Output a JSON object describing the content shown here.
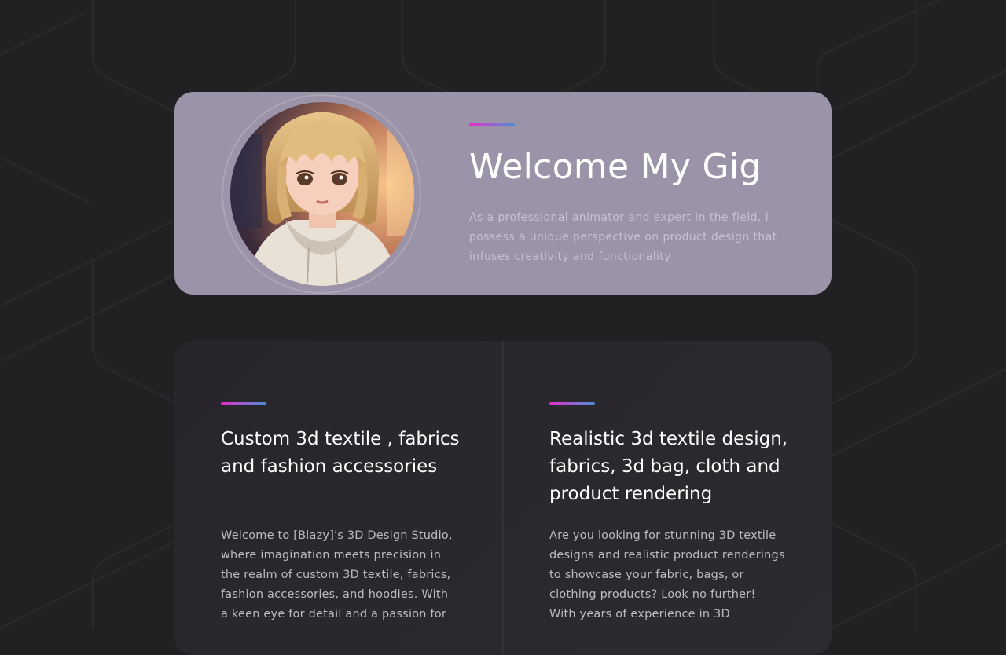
{
  "hero": {
    "title": "Welcome My Gig",
    "description": "As a professional animator and expert in the field, I possess a unique perspective on product design that infuses creativity and functionality"
  },
  "cards": [
    {
      "title": "Custom 3d textile , fabrics and fashion accessories",
      "text": "Welcome to [Blazy]'s 3D Design Studio, where imagination meets precision in the realm of custom 3D textile, fabrics, fashion accessories, and hoodies. With a keen eye for detail and a passion for"
    },
    {
      "title": "Realistic 3d textile design, fabrics, 3d bag, cloth and product rendering",
      "text": "Are you looking for stunning 3D textile designs and realistic product renderings to showcase your fabric, bags, or clothing products? Look no further! With years of experience in 3D"
    }
  ],
  "colors": {
    "page_background": "#212124",
    "hero_background": "#9b93a7",
    "accent_gradient_start": "#e12fc9",
    "accent_gradient_end": "#4a8fd0"
  }
}
